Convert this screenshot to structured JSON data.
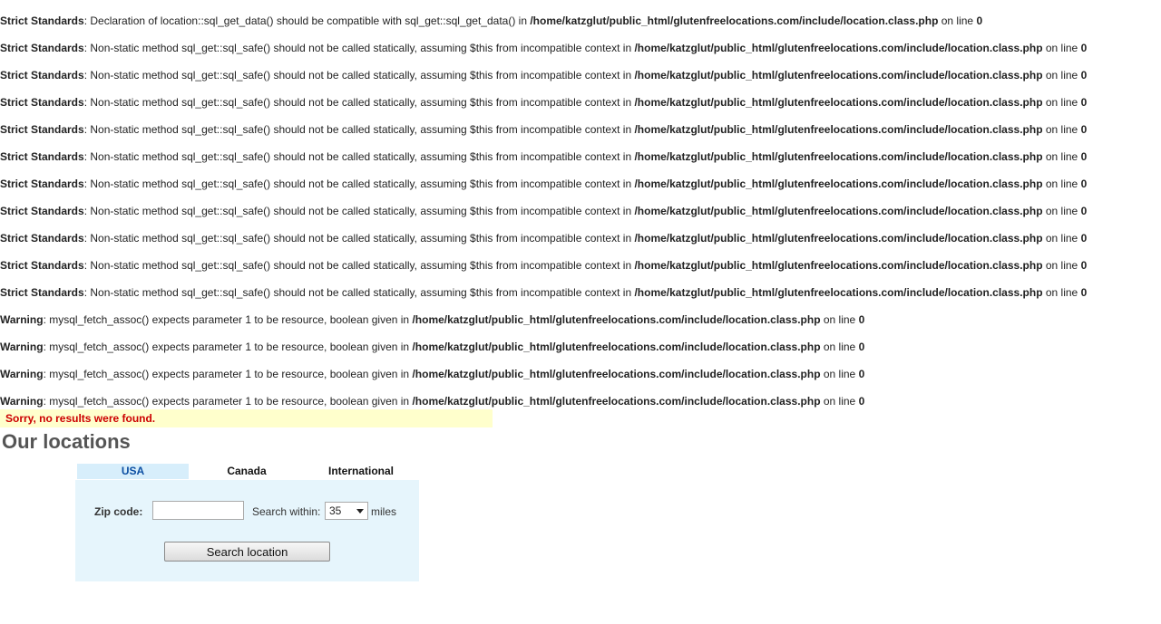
{
  "errors": [
    {
      "level": "Strict Standards",
      "message": ": Declaration of location::sql_get_data() should be compatible with sql_get::sql_get_data() in ",
      "path": "/home/katzglut/public_html/glutenfreelocations.com/include/location.class.php",
      "suffix": " on line ",
      "line": "0"
    },
    {
      "level": "Strict Standards",
      "message": ": Non-static method sql_get::sql_safe() should not be called statically, assuming $this from incompatible context in ",
      "path": "/home/katzglut/public_html/glutenfreelocations.com/include/location.class.php",
      "suffix": " on line ",
      "line": "0"
    },
    {
      "level": "Strict Standards",
      "message": ": Non-static method sql_get::sql_safe() should not be called statically, assuming $this from incompatible context in ",
      "path": "/home/katzglut/public_html/glutenfreelocations.com/include/location.class.php",
      "suffix": " on line ",
      "line": "0"
    },
    {
      "level": "Strict Standards",
      "message": ": Non-static method sql_get::sql_safe() should not be called statically, assuming $this from incompatible context in ",
      "path": "/home/katzglut/public_html/glutenfreelocations.com/include/location.class.php",
      "suffix": " on line ",
      "line": "0"
    },
    {
      "level": "Strict Standards",
      "message": ": Non-static method sql_get::sql_safe() should not be called statically, assuming $this from incompatible context in ",
      "path": "/home/katzglut/public_html/glutenfreelocations.com/include/location.class.php",
      "suffix": " on line ",
      "line": "0"
    },
    {
      "level": "Strict Standards",
      "message": ": Non-static method sql_get::sql_safe() should not be called statically, assuming $this from incompatible context in ",
      "path": "/home/katzglut/public_html/glutenfreelocations.com/include/location.class.php",
      "suffix": " on line ",
      "line": "0"
    },
    {
      "level": "Strict Standards",
      "message": ": Non-static method sql_get::sql_safe() should not be called statically, assuming $this from incompatible context in ",
      "path": "/home/katzglut/public_html/glutenfreelocations.com/include/location.class.php",
      "suffix": " on line ",
      "line": "0"
    },
    {
      "level": "Strict Standards",
      "message": ": Non-static method sql_get::sql_safe() should not be called statically, assuming $this from incompatible context in ",
      "path": "/home/katzglut/public_html/glutenfreelocations.com/include/location.class.php",
      "suffix": " on line ",
      "line": "0"
    },
    {
      "level": "Strict Standards",
      "message": ": Non-static method sql_get::sql_safe() should not be called statically, assuming $this from incompatible context in ",
      "path": "/home/katzglut/public_html/glutenfreelocations.com/include/location.class.php",
      "suffix": " on line ",
      "line": "0"
    },
    {
      "level": "Strict Standards",
      "message": ": Non-static method sql_get::sql_safe() should not be called statically, assuming $this from incompatible context in ",
      "path": "/home/katzglut/public_html/glutenfreelocations.com/include/location.class.php",
      "suffix": " on line ",
      "line": "0"
    },
    {
      "level": "Strict Standards",
      "message": ": Non-static method sql_get::sql_safe() should not be called statically, assuming $this from incompatible context in ",
      "path": "/home/katzglut/public_html/glutenfreelocations.com/include/location.class.php",
      "suffix": " on line ",
      "line": "0"
    },
    {
      "level": "Warning",
      "message": ": mysql_fetch_assoc() expects parameter 1 to be resource, boolean given in ",
      "path": "/home/katzglut/public_html/glutenfreelocations.com/include/location.class.php",
      "suffix": " on line ",
      "line": "0"
    },
    {
      "level": "Warning",
      "message": ": mysql_fetch_assoc() expects parameter 1 to be resource, boolean given in ",
      "path": "/home/katzglut/public_html/glutenfreelocations.com/include/location.class.php",
      "suffix": " on line ",
      "line": "0"
    },
    {
      "level": "Warning",
      "message": ": mysql_fetch_assoc() expects parameter 1 to be resource, boolean given in ",
      "path": "/home/katzglut/public_html/glutenfreelocations.com/include/location.class.php",
      "suffix": " on line ",
      "line": "0"
    },
    {
      "level": "Warning",
      "message": ": mysql_fetch_assoc() expects parameter 1 to be resource, boolean given in ",
      "path": "/home/katzglut/public_html/glutenfreelocations.com/include/location.class.php",
      "suffix": " on line ",
      "line": "0"
    }
  ],
  "notice": "Sorry, no results were found.",
  "page_title": "Our locations",
  "tabs": [
    {
      "label": "USA",
      "active": true
    },
    {
      "label": "Canada",
      "active": false
    },
    {
      "label": "International",
      "active": false
    }
  ],
  "form": {
    "zip_label": "Zip code:",
    "zip_value": "",
    "radius_label": "Search within:",
    "radius_value": "35",
    "radius_unit": "miles",
    "search_button": "Search location"
  },
  "colors": {
    "notice_bg": "#ffffcc",
    "notice_text": "#cc0000",
    "panel_bg": "#e6f5fc",
    "active_tab_bg": "#d7eefb",
    "active_tab_text": "#0b4ea2"
  }
}
